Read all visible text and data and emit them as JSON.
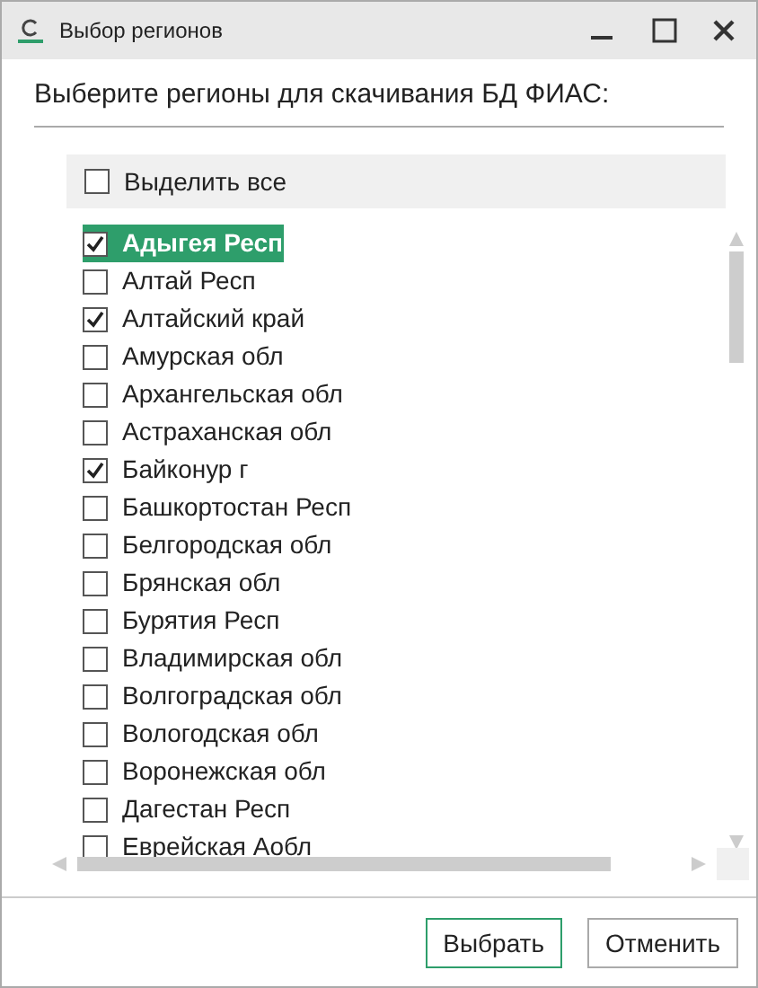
{
  "window": {
    "title": "Выбор регионов"
  },
  "heading": "Выберите регионы для скачивания БД ФИАС:",
  "select_all": {
    "label": "Выделить все",
    "checked": false
  },
  "regions": [
    {
      "label": "Адыгея Респ",
      "checked": true,
      "selected": true
    },
    {
      "label": "Алтай Респ",
      "checked": false,
      "selected": false
    },
    {
      "label": "Алтайский край",
      "checked": true,
      "selected": false
    },
    {
      "label": "Амурская обл",
      "checked": false,
      "selected": false
    },
    {
      "label": "Архангельская обл",
      "checked": false,
      "selected": false
    },
    {
      "label": "Астраханская обл",
      "checked": false,
      "selected": false
    },
    {
      "label": "Байконур г",
      "checked": true,
      "selected": false
    },
    {
      "label": "Башкортостан Респ",
      "checked": false,
      "selected": false
    },
    {
      "label": "Белгородская обл",
      "checked": false,
      "selected": false
    },
    {
      "label": "Брянская обл",
      "checked": false,
      "selected": false
    },
    {
      "label": "Бурятия Респ",
      "checked": false,
      "selected": false
    },
    {
      "label": "Владимирская обл",
      "checked": false,
      "selected": false
    },
    {
      "label": "Волгоградская обл",
      "checked": false,
      "selected": false
    },
    {
      "label": "Вологодская обл",
      "checked": false,
      "selected": false
    },
    {
      "label": "Воронежская обл",
      "checked": false,
      "selected": false
    },
    {
      "label": "Дагестан Респ",
      "checked": false,
      "selected": false
    },
    {
      "label": "Еврейская Аобл",
      "checked": false,
      "selected": false
    }
  ],
  "buttons": [
    {
      "label": "Выбрать",
      "kind": "primary"
    },
    {
      "label": "Отменить",
      "kind": "secondary"
    }
  ]
}
